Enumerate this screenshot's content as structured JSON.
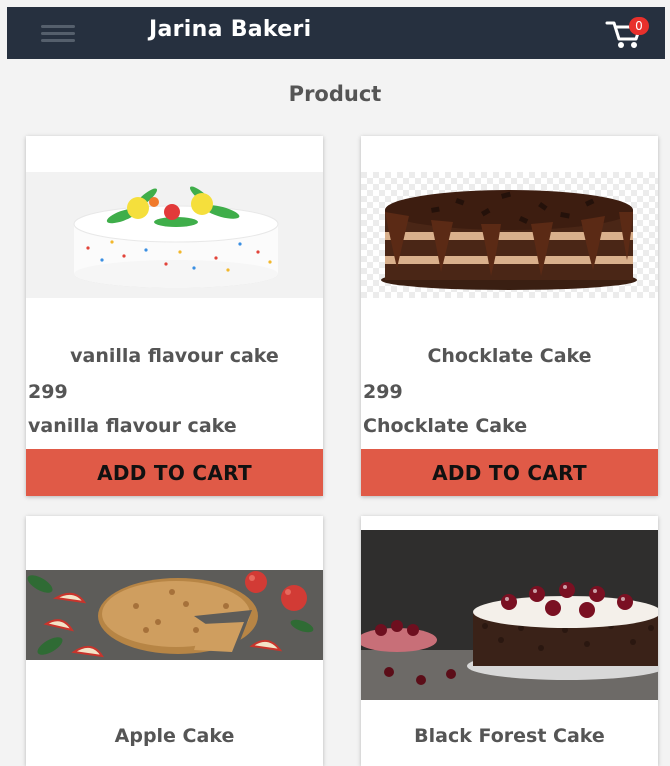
{
  "app": {
    "title": "Jarina Bakeri",
    "cart_count": "0"
  },
  "page": {
    "title": "Product"
  },
  "products": [
    {
      "name": "vanilla flavour cake",
      "price": "299",
      "description": "vanilla flavour cake",
      "button": "ADD TO CART"
    },
    {
      "name": "Chocklate Cake",
      "price": "299",
      "description": "Chocklate Cake",
      "button": "ADD TO CART"
    },
    {
      "name": "Apple Cake"
    },
    {
      "name": "Black Forest Cake"
    }
  ],
  "icons": {
    "menu": "hamburger-icon",
    "cart": "shopping-cart-icon"
  },
  "colors": {
    "appbar": "#26303f",
    "add_button": "#e05a47",
    "badge": "#e8302c",
    "background": "#f3f3f3"
  }
}
